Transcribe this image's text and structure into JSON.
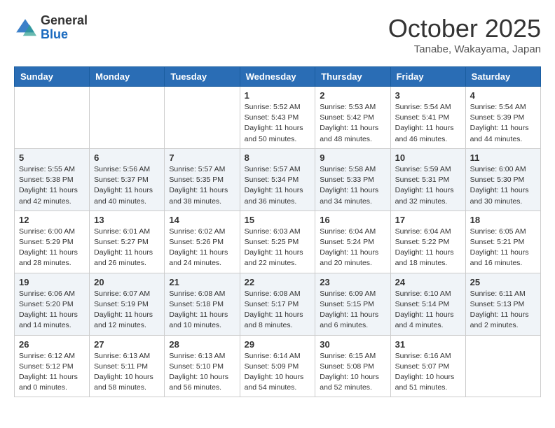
{
  "header": {
    "logo_general": "General",
    "logo_blue": "Blue",
    "month": "October 2025",
    "location": "Tanabe, Wakayama, Japan"
  },
  "columns": [
    "Sunday",
    "Monday",
    "Tuesday",
    "Wednesday",
    "Thursday",
    "Friday",
    "Saturday"
  ],
  "weeks": [
    {
      "days": [
        {
          "num": "",
          "info": ""
        },
        {
          "num": "",
          "info": ""
        },
        {
          "num": "",
          "info": ""
        },
        {
          "num": "1",
          "info": "Sunrise: 5:52 AM\nSunset: 5:43 PM\nDaylight: 11 hours\nand 50 minutes."
        },
        {
          "num": "2",
          "info": "Sunrise: 5:53 AM\nSunset: 5:42 PM\nDaylight: 11 hours\nand 48 minutes."
        },
        {
          "num": "3",
          "info": "Sunrise: 5:54 AM\nSunset: 5:41 PM\nDaylight: 11 hours\nand 46 minutes."
        },
        {
          "num": "4",
          "info": "Sunrise: 5:54 AM\nSunset: 5:39 PM\nDaylight: 11 hours\nand 44 minutes."
        }
      ]
    },
    {
      "days": [
        {
          "num": "5",
          "info": "Sunrise: 5:55 AM\nSunset: 5:38 PM\nDaylight: 11 hours\nand 42 minutes."
        },
        {
          "num": "6",
          "info": "Sunrise: 5:56 AM\nSunset: 5:37 PM\nDaylight: 11 hours\nand 40 minutes."
        },
        {
          "num": "7",
          "info": "Sunrise: 5:57 AM\nSunset: 5:35 PM\nDaylight: 11 hours\nand 38 minutes."
        },
        {
          "num": "8",
          "info": "Sunrise: 5:57 AM\nSunset: 5:34 PM\nDaylight: 11 hours\nand 36 minutes."
        },
        {
          "num": "9",
          "info": "Sunrise: 5:58 AM\nSunset: 5:33 PM\nDaylight: 11 hours\nand 34 minutes."
        },
        {
          "num": "10",
          "info": "Sunrise: 5:59 AM\nSunset: 5:31 PM\nDaylight: 11 hours\nand 32 minutes."
        },
        {
          "num": "11",
          "info": "Sunrise: 6:00 AM\nSunset: 5:30 PM\nDaylight: 11 hours\nand 30 minutes."
        }
      ]
    },
    {
      "days": [
        {
          "num": "12",
          "info": "Sunrise: 6:00 AM\nSunset: 5:29 PM\nDaylight: 11 hours\nand 28 minutes."
        },
        {
          "num": "13",
          "info": "Sunrise: 6:01 AM\nSunset: 5:27 PM\nDaylight: 11 hours\nand 26 minutes."
        },
        {
          "num": "14",
          "info": "Sunrise: 6:02 AM\nSunset: 5:26 PM\nDaylight: 11 hours\nand 24 minutes."
        },
        {
          "num": "15",
          "info": "Sunrise: 6:03 AM\nSunset: 5:25 PM\nDaylight: 11 hours\nand 22 minutes."
        },
        {
          "num": "16",
          "info": "Sunrise: 6:04 AM\nSunset: 5:24 PM\nDaylight: 11 hours\nand 20 minutes."
        },
        {
          "num": "17",
          "info": "Sunrise: 6:04 AM\nSunset: 5:22 PM\nDaylight: 11 hours\nand 18 minutes."
        },
        {
          "num": "18",
          "info": "Sunrise: 6:05 AM\nSunset: 5:21 PM\nDaylight: 11 hours\nand 16 minutes."
        }
      ]
    },
    {
      "days": [
        {
          "num": "19",
          "info": "Sunrise: 6:06 AM\nSunset: 5:20 PM\nDaylight: 11 hours\nand 14 minutes."
        },
        {
          "num": "20",
          "info": "Sunrise: 6:07 AM\nSunset: 5:19 PM\nDaylight: 11 hours\nand 12 minutes."
        },
        {
          "num": "21",
          "info": "Sunrise: 6:08 AM\nSunset: 5:18 PM\nDaylight: 11 hours\nand 10 minutes."
        },
        {
          "num": "22",
          "info": "Sunrise: 6:08 AM\nSunset: 5:17 PM\nDaylight: 11 hours\nand 8 minutes."
        },
        {
          "num": "23",
          "info": "Sunrise: 6:09 AM\nSunset: 5:15 PM\nDaylight: 11 hours\nand 6 minutes."
        },
        {
          "num": "24",
          "info": "Sunrise: 6:10 AM\nSunset: 5:14 PM\nDaylight: 11 hours\nand 4 minutes."
        },
        {
          "num": "25",
          "info": "Sunrise: 6:11 AM\nSunset: 5:13 PM\nDaylight: 11 hours\nand 2 minutes."
        }
      ]
    },
    {
      "days": [
        {
          "num": "26",
          "info": "Sunrise: 6:12 AM\nSunset: 5:12 PM\nDaylight: 11 hours\nand 0 minutes."
        },
        {
          "num": "27",
          "info": "Sunrise: 6:13 AM\nSunset: 5:11 PM\nDaylight: 10 hours\nand 58 minutes."
        },
        {
          "num": "28",
          "info": "Sunrise: 6:13 AM\nSunset: 5:10 PM\nDaylight: 10 hours\nand 56 minutes."
        },
        {
          "num": "29",
          "info": "Sunrise: 6:14 AM\nSunset: 5:09 PM\nDaylight: 10 hours\nand 54 minutes."
        },
        {
          "num": "30",
          "info": "Sunrise: 6:15 AM\nSunset: 5:08 PM\nDaylight: 10 hours\nand 52 minutes."
        },
        {
          "num": "31",
          "info": "Sunrise: 6:16 AM\nSunset: 5:07 PM\nDaylight: 10 hours\nand 51 minutes."
        },
        {
          "num": "",
          "info": ""
        }
      ]
    }
  ]
}
